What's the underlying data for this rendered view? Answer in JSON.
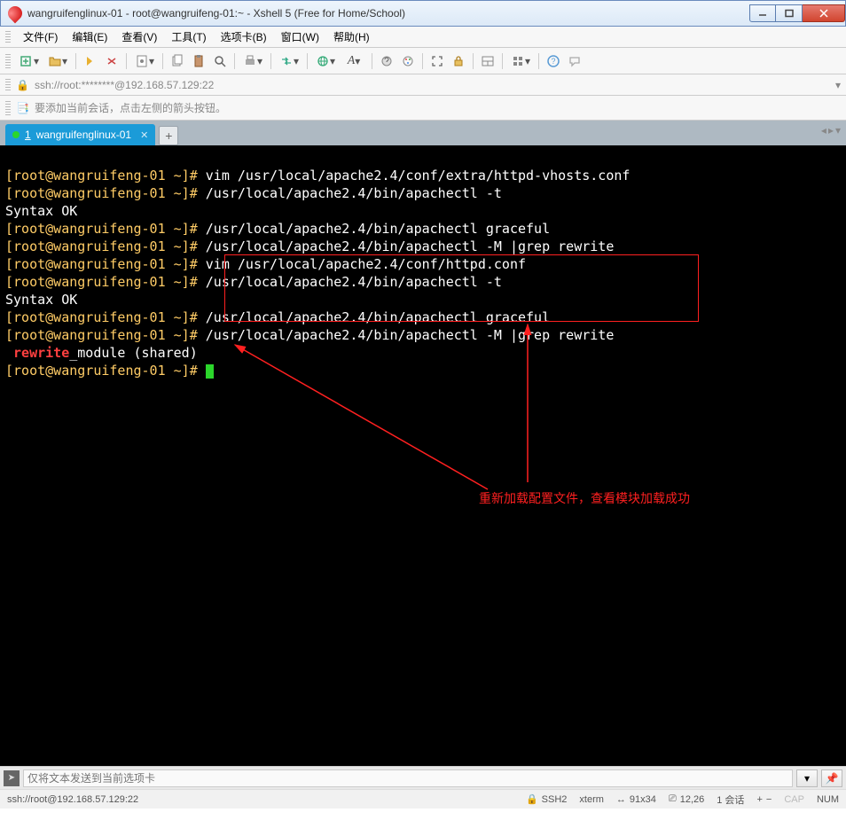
{
  "window": {
    "title": "wangruifenglinux-01 - root@wangruifeng-01:~ - Xshell 5 (Free for Home/School)"
  },
  "menu": {
    "file": "文件(F)",
    "edit": "编辑(E)",
    "view": "查看(V)",
    "tools": "工具(T)",
    "tabs": "选项卡(B)",
    "window": "窗口(W)",
    "help": "帮助(H)"
  },
  "address": "ssh://root:********@192.168.57.129:22",
  "hint": "要添加当前会话，点击左侧的箭头按钮。",
  "tab": {
    "num": "1",
    "name": "wangruifenglinux-01"
  },
  "term": {
    "prompt": "[root@wangruifeng-01 ~]# ",
    "l1": "vim /usr/local/apache2.4/conf/extra/httpd-vhosts.conf",
    "l2": "/usr/local/apache2.4/bin/apachectl -t",
    "l3": "Syntax OK",
    "l4": "/usr/local/apache2.4/bin/apachectl graceful",
    "l5": "/usr/local/apache2.4/bin/apachectl -M |grep rewrite",
    "l6": "vim /usr/local/apache2.4/conf/httpd.conf",
    "l7": "/usr/local/apache2.4/bin/apachectl -t",
    "l8": "Syntax OK",
    "l9": "/usr/local/apache2.4/bin/apachectl graceful",
    "l10": "/usr/local/apache2.4/bin/apachectl -M |grep rewrite",
    "l11a": " rewrite",
    "l11b": "_module (shared)",
    "l12": ""
  },
  "annotation": "重新加载配置文件，查看模块加载成功",
  "send_placeholder": "仅将文本发送到当前选项卡",
  "status": {
    "conn": "ssh://root@192.168.57.129:22",
    "proto": "SSH2",
    "term": "xterm",
    "size": "91x34",
    "pos": "12,26",
    "sess": "1 会话",
    "cap": "CAP",
    "num": "NUM"
  }
}
